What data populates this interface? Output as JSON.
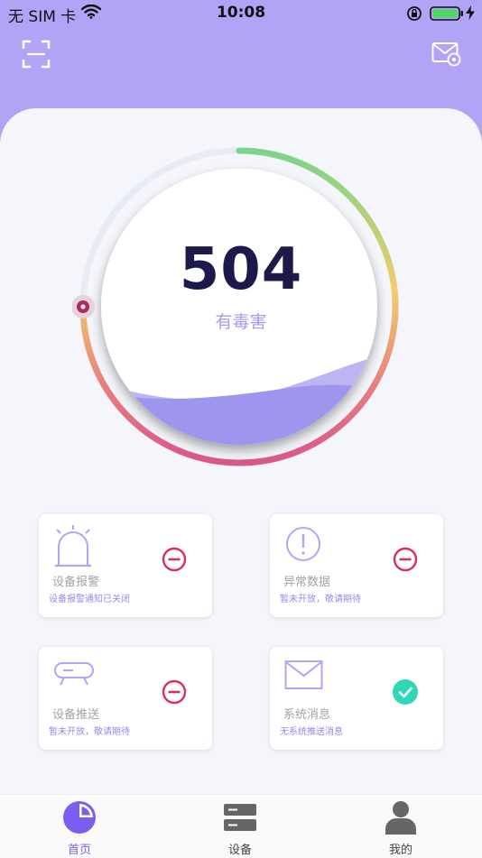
{
  "status_bar": {
    "carrier": "无 SIM 卡",
    "time": "10:08"
  },
  "gauge": {
    "value": "504",
    "label": "有毒害",
    "fill_fraction": 0.75
  },
  "tiles": [
    {
      "title": "设备报警",
      "subtitle": "设备报警通知已关闭",
      "icon": "alarm-light-icon",
      "status": "disabled"
    },
    {
      "title": "异常数据",
      "subtitle": "暂未开放，敬请期待",
      "icon": "exclamation-circle-icon",
      "status": "disabled"
    },
    {
      "title": "设备推送",
      "subtitle": "暂未开放，敬请期待",
      "icon": "device-icon",
      "status": "disabled"
    },
    {
      "title": "系统消息",
      "subtitle": "无系统推送消息",
      "icon": "envelope-icon",
      "status": "enabled"
    }
  ],
  "tab_bar": {
    "items": [
      {
        "label": "首页",
        "active": true
      },
      {
        "label": "设备",
        "active": false
      },
      {
        "label": "我的",
        "active": false
      }
    ]
  },
  "colors": {
    "header_bg": "#b1a3f6",
    "accent": "#7c5ff0",
    "disabled_red": "#d8305c",
    "enabled_teal": "#2fd7b6",
    "gauge_green": "#7bd48a",
    "gauge_yellow": "#f2cd68",
    "gauge_pink": "#d9568c"
  }
}
